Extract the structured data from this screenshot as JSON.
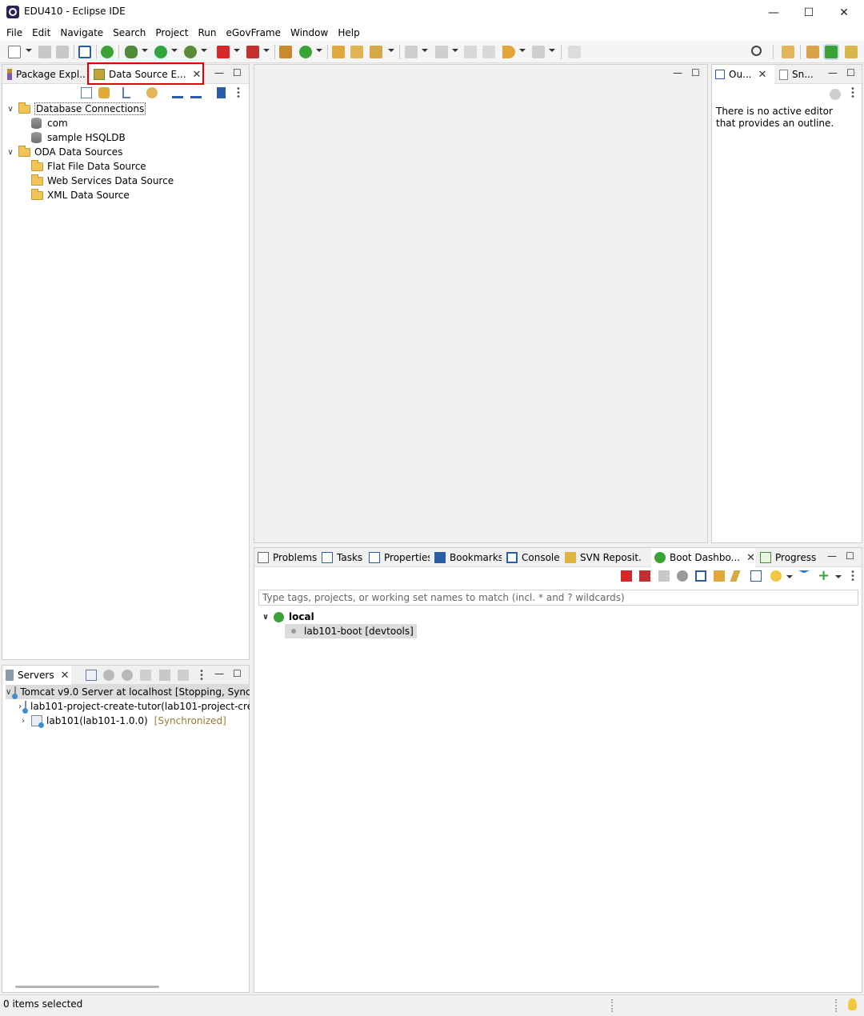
{
  "window": {
    "title": "EDU410 - Eclipse IDE",
    "minimize": "—",
    "maximize": "☐",
    "close": "✕"
  },
  "menu": [
    "File",
    "Edit",
    "Navigate",
    "Search",
    "Project",
    "Run",
    "eGovFrame",
    "Window",
    "Help"
  ],
  "left_tabs": {
    "package_explorer": "Package Expl...",
    "data_source_explorer": "Data Source E..."
  },
  "tree": {
    "database_connections": "Database Connections",
    "com": "com",
    "sample_hsqldb": "sample HSQLDB",
    "oda_data_sources": "ODA Data Sources",
    "flat_file": "Flat File Data Source",
    "web_services": "Web Services Data Source",
    "xml": "XML Data Source"
  },
  "servers": {
    "tab": "Servers",
    "tomcat": "Tomcat v9.0 Server at localhost  [Stopping, Synch",
    "module1": "lab101-project-create-tutor(lab101-project-crea",
    "module2": "lab101(lab101-1.0.0)",
    "module2_status": "[Synchronized]"
  },
  "right_tabs": {
    "outline": "Ou...",
    "snippets": "Sn..."
  },
  "outline_message": "There is no active editor that provides an outline.",
  "bottom_tabs": [
    "Problems",
    "Tasks",
    "Properties",
    "Bookmarks",
    "Console",
    "SVN Reposit...",
    "Boot Dashbo...",
    "Progress"
  ],
  "boot": {
    "filter_placeholder": "Type tags, projects, or working set names to match (incl. * and ? wildcards)",
    "local": "local",
    "app": "lab101-boot [devtools]"
  },
  "status": "0 items selected",
  "colors": {
    "highlight_box": "#e00000",
    "spring_green": "#3aa335",
    "selection": "#dcdcdc"
  }
}
